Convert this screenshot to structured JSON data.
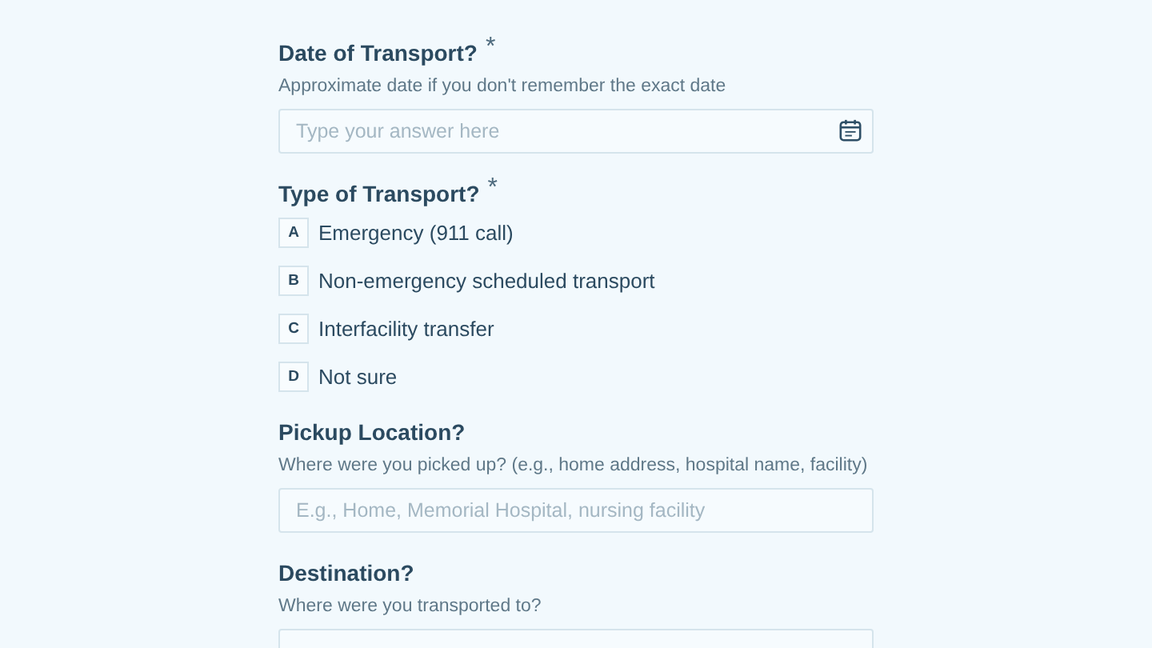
{
  "questions": [
    {
      "kind": "date",
      "title": "Date of Transport?",
      "required_mark": "*",
      "helper": "Approximate date if you don't remember the exact date",
      "placeholder": "Type your answer here"
    },
    {
      "kind": "choice",
      "title": "Type of Transport?",
      "required_mark": "*",
      "options": [
        {
          "key": "A",
          "label": "Emergency (911 call)"
        },
        {
          "key": "B",
          "label": "Non-emergency scheduled transport"
        },
        {
          "key": "C",
          "label": "Interfacility transfer"
        },
        {
          "key": "D",
          "label": "Not sure"
        }
      ]
    },
    {
      "kind": "text",
      "title": "Pickup Location?",
      "helper": "Where were you picked up? (e.g., home address, hospital name, facility)",
      "placeholder": "E.g., Home, Memorial Hospital, nursing facility"
    },
    {
      "kind": "text",
      "title": "Destination?",
      "helper": "Where were you transported to?"
    }
  ]
}
